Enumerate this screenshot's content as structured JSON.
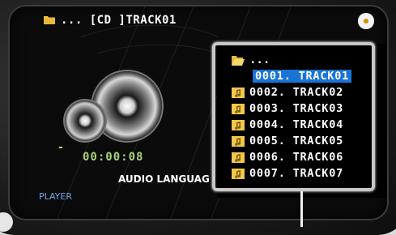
{
  "header": {
    "path": "... [CD ]TRACK01"
  },
  "player": {
    "dash": "-",
    "time": "00:00:08",
    "audio_language": "AUDIO LANGUAG",
    "label": "PLAYER"
  },
  "file_list": {
    "parent": "...",
    "items": [
      {
        "name": "0001. TRACK01",
        "selected": true
      },
      {
        "name": "0002. TRACK02",
        "selected": false
      },
      {
        "name": "0003. TRACK03",
        "selected": false
      },
      {
        "name": "0004. TRACK04",
        "selected": false
      },
      {
        "name": "0005. TRACK05",
        "selected": false
      },
      {
        "name": "0006. TRACK06",
        "selected": false
      },
      {
        "name": "0007. TRACK07",
        "selected": false
      }
    ]
  },
  "colors": {
    "accent_time": "#a7d17a",
    "player_label": "#70a6e8",
    "selection": "#1a74d6",
    "folder": "#f2c84b"
  },
  "icons": {
    "header_folder": "folder-icon",
    "disc": "disc-icon",
    "parent_folder": "open-folder-icon",
    "file": "music-file-icon"
  }
}
